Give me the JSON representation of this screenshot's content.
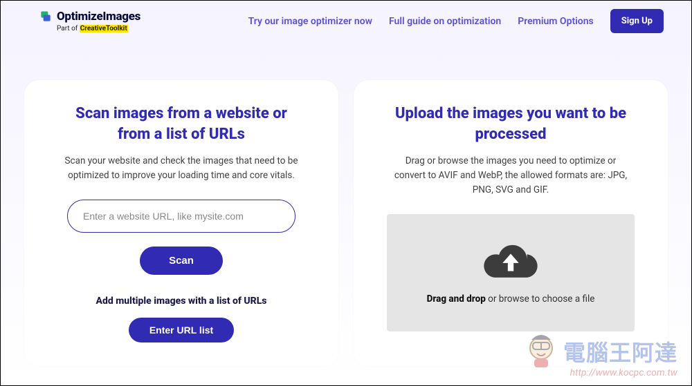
{
  "brand": {
    "name": "OptimizeImages",
    "sub_prefix": "Part of ",
    "sub_highlight": "CreativeToolkit"
  },
  "nav": {
    "link1": "Try our image optimizer now",
    "link2": "Full guide on optimization",
    "link3": "Premium Options",
    "signup": "Sign Up"
  },
  "scan": {
    "title": "Scan images from a website or from a list of URLs",
    "desc": "Scan your website and check the images that need to be optimized to improve your loading time and core vitals.",
    "placeholder": "Enter a website URL, like mysite.com",
    "scan_btn": "Scan",
    "subhead": "Add multiple images with a list of URLs",
    "url_list_btn": "Enter URL list"
  },
  "upload": {
    "title": "Upload the images you want to be processed",
    "desc": "Drag or browse the images you need to optimize or convert to AVIF and WebP, the allowed formats are: JPG, PNG, SVG and GIF.",
    "drop_bold": "Drag and drop",
    "drop_rest": " or browse to choose a file"
  },
  "watermark": {
    "text": "電腦王阿達",
    "url": "http://www.kocpc.com.tw"
  }
}
